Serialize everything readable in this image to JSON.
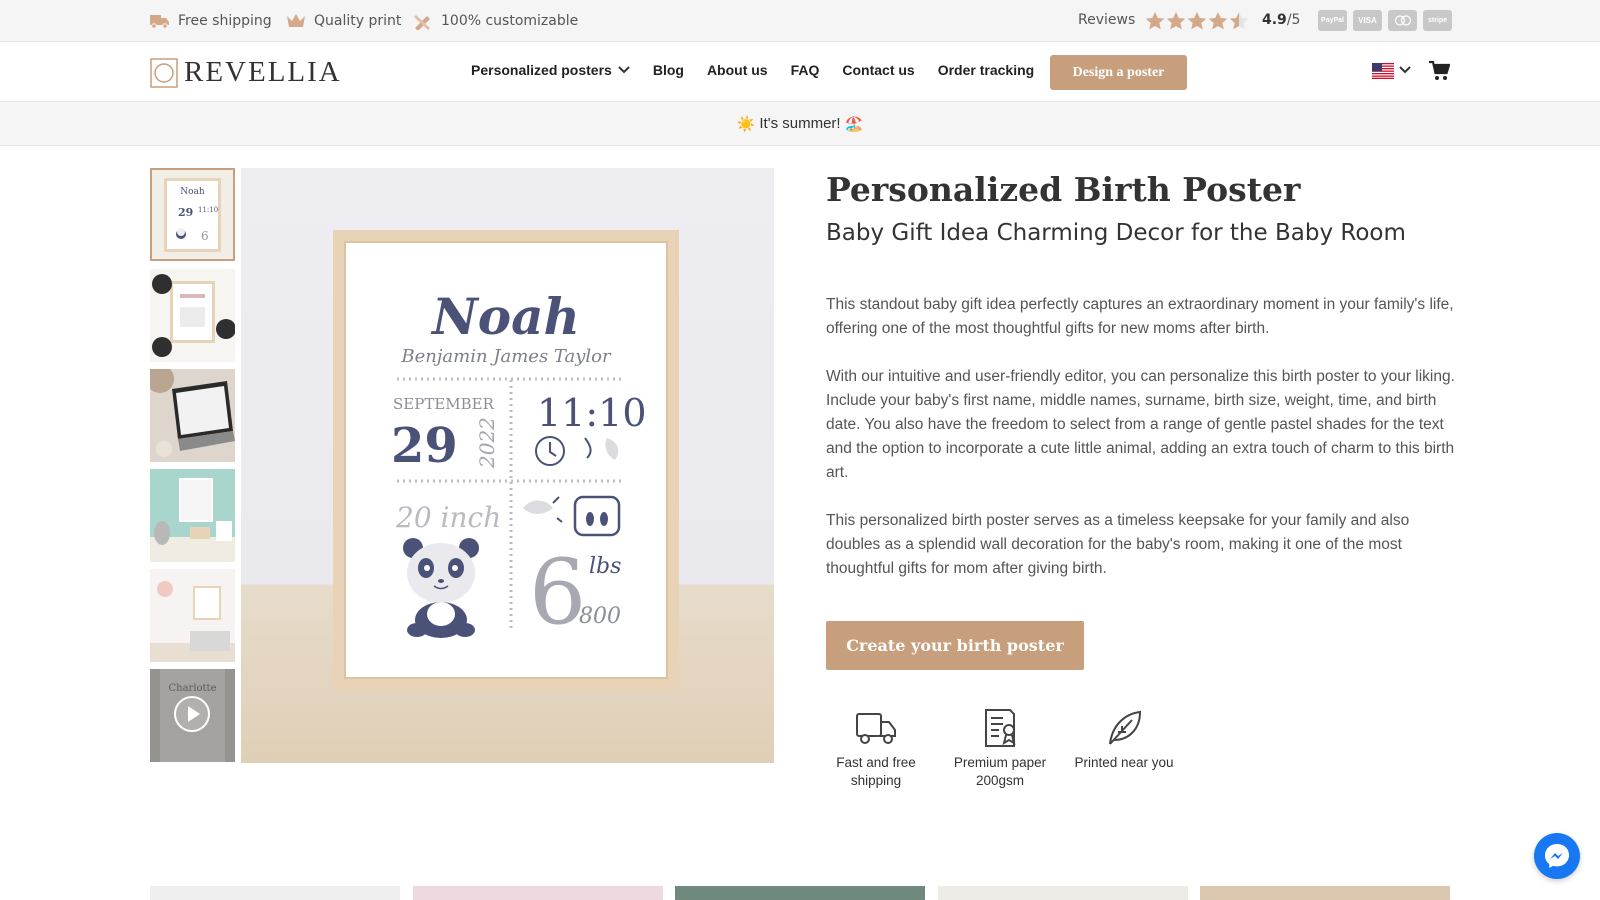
{
  "topbar": {
    "perks": [
      "Free shipping",
      "Quality print",
      "100% customizable"
    ],
    "reviews_label": "Reviews",
    "rating_value": "4.9",
    "rating_scale": "/5",
    "stars": 4.5,
    "payments": [
      "PayPal",
      "VISA",
      "",
      "stripe"
    ]
  },
  "nav": {
    "logo": "REVELLIA",
    "links": [
      "Personalized posters",
      "Blog",
      "About us",
      "FAQ",
      "Contact us",
      "Order tracking"
    ],
    "design_button": "Design a poster",
    "accent": "#c79f7d"
  },
  "banner": {
    "text": "It's summer!",
    "icon_left": "☀️",
    "icon_right": "🏖️"
  },
  "gallery": {
    "thumbnails": [
      "poster-noah",
      "poster-annotated",
      "laptop-editor",
      "mint-nursery",
      "pink-nursery",
      "video-charlotte"
    ],
    "poster": {
      "name": "Noah",
      "middle": "Benjamin James Taylor",
      "month": "SEPTEMBER",
      "day": "29",
      "year": "2022",
      "time": "11:10",
      "size": "20 inch",
      "weight_big": "6",
      "weight_small": "800",
      "weight_unit": "lbs",
      "thumb_video_name": "Charlotte"
    }
  },
  "product": {
    "title": "Personalized Birth Poster",
    "subtitle": "Baby Gift Idea Charming Decor for the Baby Room",
    "paragraphs": [
      "This standout baby gift idea perfectly captures an extraordinary moment in your family's life, offering one of the most thoughtful gifts for new moms after birth.",
      "With our intuitive and user-friendly editor, you can personalize this birth poster to your liking. Include your baby's first name, middle names, surname, birth size, weight, time, and birth date. You also have the freedom to select from a range of gentle pastel shades for the text and the option to incorporate a cute little animal, adding an extra touch of charm to this birth art.",
      "This personalized birth poster serves as a timeless keepsake for your family and also doubles as a splendid wall decoration for the baby's room, making it one of the most thoughtful gifts for mom after giving birth."
    ],
    "cta": "Create your birth poster",
    "features": [
      {
        "icon": "truck-icon",
        "label": "Fast and free shipping"
      },
      {
        "icon": "paper-icon",
        "label": "Premium paper 200gsm"
      },
      {
        "icon": "leaf-icon",
        "label": "Printed near you"
      }
    ]
  }
}
